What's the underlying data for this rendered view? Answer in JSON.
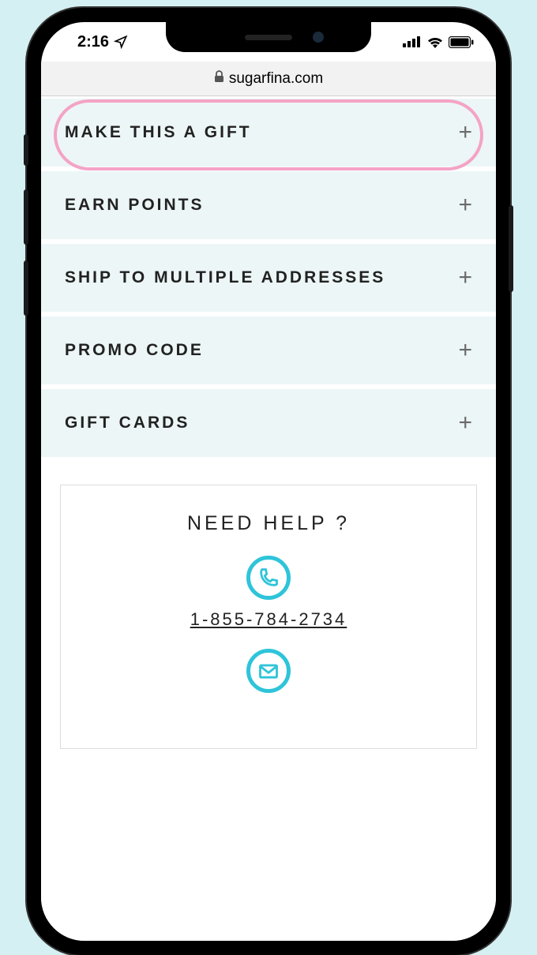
{
  "status": {
    "time": "2:16",
    "location_icon": "location-arrow-icon"
  },
  "browser": {
    "domain": "sugarfina.com",
    "secure": true
  },
  "accordion": {
    "items": [
      {
        "label": "MAKE THIS A GIFT",
        "expand": "+"
      },
      {
        "label": "EARN POINTS",
        "expand": "+"
      },
      {
        "label": "SHIP TO MULTIPLE ADDRESSES",
        "expand": "+"
      },
      {
        "label": "PROMO CODE",
        "expand": "+"
      },
      {
        "label": "GIFT CARDS",
        "expand": "+"
      }
    ]
  },
  "help": {
    "title": "NEED HELP ?",
    "phone": "1-855-784-2734"
  },
  "colors": {
    "accent": "#2ec4d9",
    "highlight": "#f4a3c5",
    "panel_bg": "#ecf6f7"
  }
}
